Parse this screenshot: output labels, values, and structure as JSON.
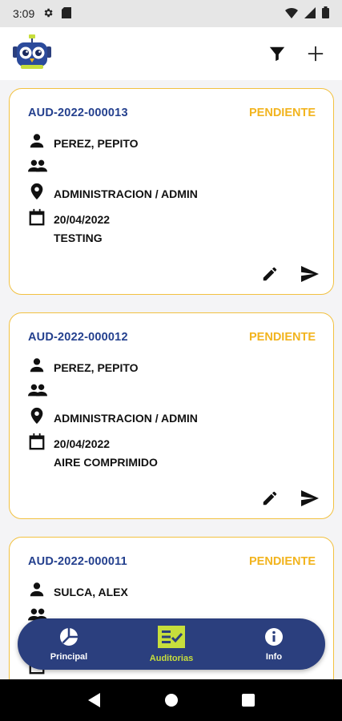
{
  "status_bar": {
    "time": "3:09",
    "icons": [
      "gear-icon",
      "sd-card-icon",
      "wifi-icon",
      "signal-icon",
      "battery-icon"
    ]
  },
  "app_bar": {
    "logo": "owl-robot-logo",
    "actions": [
      "filter-icon",
      "add-icon"
    ]
  },
  "colors": {
    "accent_yellow": "#f2b41e",
    "primary_blue": "#24408e",
    "nav_bg": "#2b3f7e",
    "active_green": "#c7de3c"
  },
  "audits": [
    {
      "code": "AUD-2022-000013",
      "status": "PENDIENTE",
      "auditor": "PEREZ, PEPITO",
      "team": "",
      "area": "ADMINISTRACION / ADMIN",
      "date": "20/04/2022",
      "description": "TESTING"
    },
    {
      "code": "AUD-2022-000012",
      "status": "PENDIENTE",
      "auditor": "PEREZ, PEPITO",
      "team": "",
      "area": "ADMINISTRACION / ADMIN",
      "date": "20/04/2022",
      "description": "AIRE COMPRIMIDO"
    },
    {
      "code": "AUD-2022-000011",
      "status": "PENDIENTE",
      "auditor": "SULCA, ALEX",
      "team": "",
      "area": "",
      "date": "",
      "description": ""
    }
  ],
  "bottom_nav": [
    {
      "label": "Principal",
      "icon": "pie-chart-icon",
      "active": false
    },
    {
      "label": "Auditorias",
      "icon": "checklist-icon",
      "active": true
    },
    {
      "label": "Info",
      "icon": "info-icon",
      "active": false
    }
  ]
}
